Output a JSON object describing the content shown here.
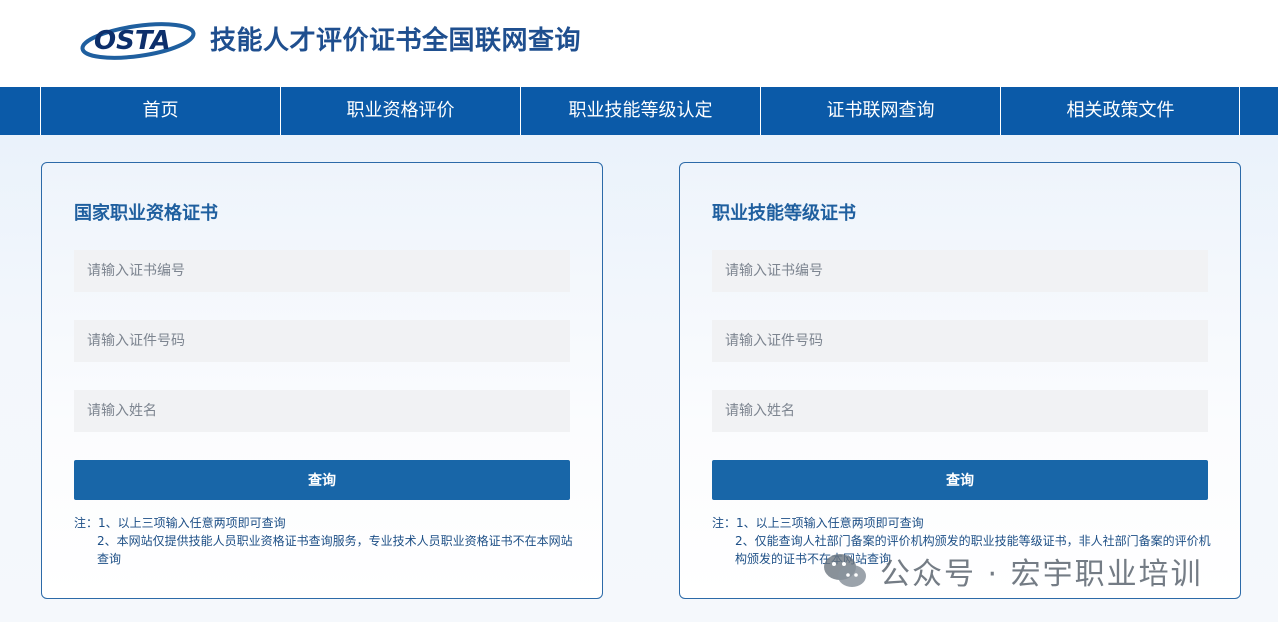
{
  "header": {
    "logo_text": "OSTA",
    "title": "技能人才评价证书全国联网查询"
  },
  "nav": {
    "items": [
      {
        "label": "首页"
      },
      {
        "label": "职业资格评价"
      },
      {
        "label": "职业技能等级认定"
      },
      {
        "label": "证书联网查询"
      },
      {
        "label": "相关政策文件"
      }
    ]
  },
  "panels": [
    {
      "title": "国家职业资格证书",
      "cert_no_placeholder": "请输入证书编号",
      "id_no_placeholder": "请输入证件号码",
      "name_placeholder": "请输入姓名",
      "button_label": "查询",
      "note_1": "注：1、以上三项输入任意两项即可查询",
      "note_2": "2、本网站仅提供技能人员职业资格证书查询服务，专业技术人员职业资格证书不在本网站查询"
    },
    {
      "title": "职业技能等级证书",
      "cert_no_placeholder": "请输入证书编号",
      "id_no_placeholder": "请输入证件号码",
      "name_placeholder": "请输入姓名",
      "button_label": "查询",
      "note_1": "注：1、以上三项输入任意两项即可查询",
      "note_2": "2、仅能查询人社部门备案的评价机构颁发的职业技能等级证书，非人社部门备案的评价机构颁发的证书不在本网站查询"
    }
  ],
  "watermark": {
    "text": "公众号 · 宏宇职业培训",
    "icon": "wechat-icon"
  }
}
